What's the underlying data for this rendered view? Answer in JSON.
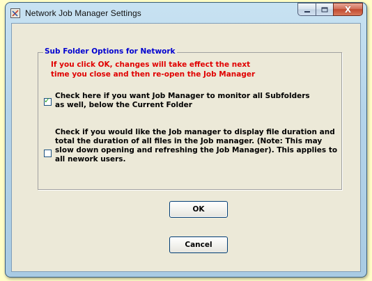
{
  "window": {
    "title": "Network Job Manager Settings",
    "icon": "job-manager-app-icon",
    "controls": {
      "minimize_icon": "minimize-icon",
      "maximize_icon": "maximize-icon",
      "close_icon": "close-icon",
      "close_glyph": "X"
    }
  },
  "group": {
    "title": "Sub Folder Options for Network",
    "warning": "If you click OK, changes will take effect the next\ntime you close and then re-open the Job Manager"
  },
  "options": [
    {
      "label": "Check here if you want Job Manager to monitor all Subfolders\nas well,  below the Current Folder",
      "checked": true
    },
    {
      "label": "Check if you would like the Job manager to display file duration and\ntotal the duration of all files in the Job manager. (Note: This may\nslow down opening and refreshing the Job Manager). This applies to\nall nework users.",
      "checked": false
    }
  ],
  "buttons": {
    "ok_label": "OK",
    "cancel_label": "Cancel"
  },
  "colors": {
    "legend": "#0000d0",
    "warning": "#e00000",
    "checkmark": "#21a121",
    "background": "#fffec8",
    "dialog_face": "#ece9d8"
  }
}
